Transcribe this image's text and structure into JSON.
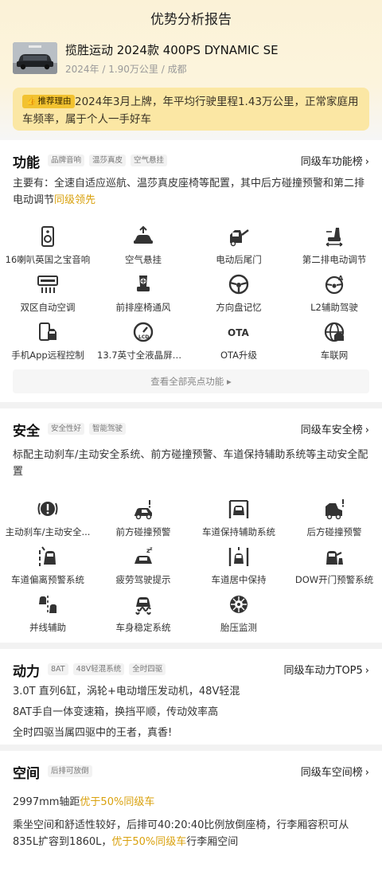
{
  "page_title": "优势分析报告",
  "car": {
    "name": "揽胜运动 2024款 400PS DYNAMIC SE",
    "meta": "2024年 / 1.90万公里 / 成都",
    "image_alt": "car-photo"
  },
  "reason": {
    "tag": "推荐理由",
    "text": "2024年3月上牌，年平均行驶里程1.43万公里，正常家庭用车频率，属于个人一手好车"
  },
  "function": {
    "title": "功能",
    "chips": [
      "品牌音响",
      "温莎真皮",
      "空气悬挂"
    ],
    "rank": "同级车功能榜",
    "summary_main": "主要有：全速自适应巡航、温莎真皮座椅等配置，其中后方碰撞预警和第二排电动调节",
    "summary_highlight": "同级领先",
    "features": [
      {
        "label": "16喇叭英国之宝音响",
        "icon": "speaker-icon"
      },
      {
        "label": "空气悬挂",
        "icon": "air-suspension-icon"
      },
      {
        "label": "电动后尾门",
        "icon": "power-tailgate-icon"
      },
      {
        "label": "第二排电动调节",
        "icon": "seat-adjust-icon"
      },
      {
        "label": "双区自动空调",
        "icon": "dual-zone-ac-icon"
      },
      {
        "label": "前排座椅通风",
        "icon": "seat-ventilation-icon"
      },
      {
        "label": "方向盘记忆",
        "icon": "steering-wheel-icon"
      },
      {
        "label": "L2辅助驾驶",
        "icon": "assisted-driving-icon"
      },
      {
        "label": "手机App远程控制",
        "icon": "phone-remote-icon"
      },
      {
        "label": "13.7英寸全液晶屏仪表",
        "icon": "lcd-dashboard-icon"
      },
      {
        "label": "OTA升级",
        "icon": "ota-icon"
      },
      {
        "label": "车联网",
        "icon": "connected-car-icon"
      }
    ],
    "all_button": "查看全部亮点功能"
  },
  "safety": {
    "title": "安全",
    "chips": [
      "安全性好",
      "智能驾驶"
    ],
    "rank": "同级车安全榜",
    "summary": "标配主动刹车/主动安全系统、前方碰撞预警、车道保持辅助系统等主动安全配置",
    "features": [
      {
        "label": "主动刹车/主动安全...",
        "icon": "active-brake-icon"
      },
      {
        "label": "前方碰撞预警",
        "icon": "front-collision-icon"
      },
      {
        "label": "车道保持辅助系统",
        "icon": "lane-keep-icon"
      },
      {
        "label": "后方碰撞预警",
        "icon": "rear-collision-icon"
      },
      {
        "label": "车道偏离预警系统",
        "icon": "lane-departure-icon"
      },
      {
        "label": "疲劳驾驶提示",
        "icon": "fatigue-icon"
      },
      {
        "label": "车道居中保持",
        "icon": "lane-center-icon"
      },
      {
        "label": "DOW开门预警系统",
        "icon": "door-open-warning-icon"
      },
      {
        "label": "并线辅助",
        "icon": "blind-spot-icon"
      },
      {
        "label": "车身稳定系统",
        "icon": "stability-icon"
      },
      {
        "label": "胎压监测",
        "icon": "tire-pressure-icon"
      }
    ]
  },
  "power": {
    "title": "动力",
    "chips": [
      "8AT",
      "48V轻混系统",
      "全时四驱"
    ],
    "rank": "同级车动力TOP5",
    "lines": [
      "3.0T 直列6缸，涡轮+电动增压发动机，48V轻混",
      "8AT手自一体变速箱，换挡平顺，传动效率高",
      "全时四驱当属四驱中的王者，真香!"
    ]
  },
  "space": {
    "title": "空间",
    "chips": [
      "后排可放倒"
    ],
    "rank": "同级车空间榜",
    "line1_main": "2997mm轴距",
    "line1_highlight": "优于50%同级车",
    "line2_main": "乘坐空间和舒适性较好，后排可40:20:40比例放倒座椅，行李厢容积可从835L扩容到1860L，",
    "line2_highlight": "优于50%同级车",
    "line2_tail": "行李厢空间"
  },
  "colors": {
    "accent": "#d9a10d",
    "reason_bg": "#fbe7a4",
    "tag_bg": "#f2c230"
  }
}
